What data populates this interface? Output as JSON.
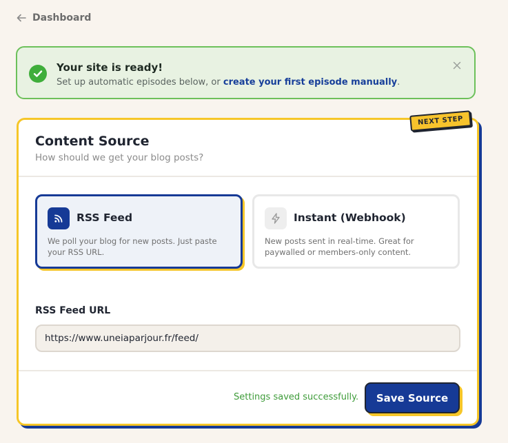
{
  "nav": {
    "back_label": "Dashboard",
    "back_icon": "arrow-left-icon"
  },
  "alert": {
    "title": "Your site is ready!",
    "message_prefix": "Set up automatic episodes below, or ",
    "link_text": "create your first episode manually",
    "message_suffix": ".",
    "icon": "check-circle-icon",
    "close_icon": "close-icon",
    "colors": {
      "border": "#6cc05a",
      "background": "#e8f2e2",
      "link": "#173f9a"
    }
  },
  "card": {
    "badge": "NEXT STEP",
    "title": "Content Source",
    "subtitle": "How should we get your blog posts?",
    "options": [
      {
        "label": "RSS Feed",
        "description": "We poll your blog for new posts. Just paste your RSS URL.",
        "icon": "rss-icon",
        "selected": true
      },
      {
        "label": "Instant (Webhook)",
        "description": "New posts sent in real-time. Great for paywalled or members-only content.",
        "icon": "lightning-icon",
        "selected": false
      }
    ],
    "field_label": "RSS Feed URL",
    "field_value": "https://www.uneiaparjour.fr/feed/",
    "status": "Settings saved successfully.",
    "save_label": "Save Source"
  },
  "colors": {
    "accent": "#163a96",
    "highlight": "#f6c628",
    "success": "#3f9c3a",
    "page_bg": "#f9f4ee"
  }
}
